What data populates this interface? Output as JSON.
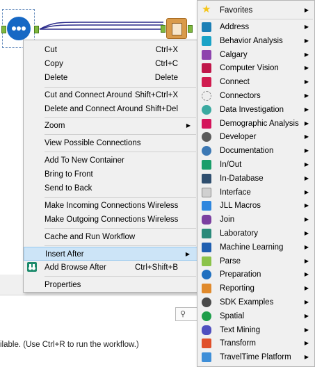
{
  "canvas": {},
  "context_menu": {
    "items": [
      {
        "label": "Cut",
        "shortcut": "Ctrl+X"
      },
      {
        "label": "Copy",
        "shortcut": "Ctrl+C"
      },
      {
        "label": "Delete",
        "shortcut": "Delete"
      },
      {
        "label": "Cut and Connect Around",
        "shortcut": "Shift+Ctrl+X"
      },
      {
        "label": "Delete and Connect Around",
        "shortcut": "Shift+Del"
      },
      {
        "label": "Zoom",
        "shortcut": ""
      },
      {
        "label": "View Possible Connections",
        "shortcut": ""
      },
      {
        "label": "Add To New Container",
        "shortcut": ""
      },
      {
        "label": "Bring to Front",
        "shortcut": ""
      },
      {
        "label": "Send to Back",
        "shortcut": ""
      },
      {
        "label": "Make Incoming Connections Wireless",
        "shortcut": ""
      },
      {
        "label": "Make Outgoing Connections Wireless",
        "shortcut": ""
      },
      {
        "label": "Cache and Run Workflow",
        "shortcut": ""
      },
      {
        "label": "Insert After",
        "shortcut": ""
      },
      {
        "label": "Add Browse After",
        "shortcut": "Ctrl+Shift+B"
      },
      {
        "label": "Properties",
        "shortcut": ""
      }
    ]
  },
  "submenu": {
    "items": [
      {
        "label": "Favorites",
        "color": "#f5c518",
        "icon": "star-icon"
      },
      {
        "label": "Address",
        "color": "#1b7fb5",
        "icon": "address-icon"
      },
      {
        "label": "Behavior Analysis",
        "color": "#1aa3c7",
        "icon": "behavior-analysis-icon"
      },
      {
        "label": "Calgary",
        "color": "#8e44ad",
        "icon": "calgary-icon"
      },
      {
        "label": "Computer Vision",
        "color": "#c0174a",
        "icon": "computer-vision-icon"
      },
      {
        "label": "Connect",
        "color": "#d01c4f",
        "icon": "connect-icon"
      },
      {
        "label": "Connectors",
        "color": "#bdbdbd",
        "icon": "connectors-icon"
      },
      {
        "label": "Data Investigation",
        "color": "#3aa9a0",
        "icon": "data-investigation-icon"
      },
      {
        "label": "Demographic Analysis",
        "color": "#d4145a",
        "icon": "demographic-analysis-icon"
      },
      {
        "label": "Developer",
        "color": "#5a5a5a",
        "icon": "developer-icon"
      },
      {
        "label": "Documentation",
        "color": "#3c78b4",
        "icon": "documentation-icon"
      },
      {
        "label": "In/Out",
        "color": "#1a9e6a",
        "icon": "in-out-icon"
      },
      {
        "label": "In-Database",
        "color": "#2f4f6f",
        "icon": "in-database-icon"
      },
      {
        "label": "Interface",
        "color": "#d0d0d0",
        "icon": "interface-icon"
      },
      {
        "label": "JLL Macros",
        "color": "#2e86de",
        "icon": "jll-macros-icon"
      },
      {
        "label": "Join",
        "color": "#7b3fa0",
        "icon": "join-icon"
      },
      {
        "label": "Laboratory",
        "color": "#2a8a7a",
        "icon": "laboratory-icon"
      },
      {
        "label": "Machine Learning",
        "color": "#1f5fb0",
        "icon": "machine-learning-icon"
      },
      {
        "label": "Parse",
        "color": "#8bc34a",
        "icon": "parse-icon"
      },
      {
        "label": "Preparation",
        "color": "#1f6fbf",
        "icon": "preparation-icon"
      },
      {
        "label": "Reporting",
        "color": "#e08a2c",
        "icon": "reporting-icon"
      },
      {
        "label": "SDK Examples",
        "color": "#4a4a4a",
        "icon": "sdk-examples-icon"
      },
      {
        "label": "Spatial",
        "color": "#1e9e4a",
        "icon": "spatial-icon"
      },
      {
        "label": "Text Mining",
        "color": "#4f4fbf",
        "icon": "text-mining-icon"
      },
      {
        "label": "Transform",
        "color": "#e0502a",
        "icon": "transform-icon"
      },
      {
        "label": "TravelTime Platform",
        "color": "#3f8fd8",
        "icon": "traveltime-platform-icon"
      }
    ]
  },
  "status": {
    "text": "ilable. (Use Ctrl+R to run the workflow.)"
  }
}
